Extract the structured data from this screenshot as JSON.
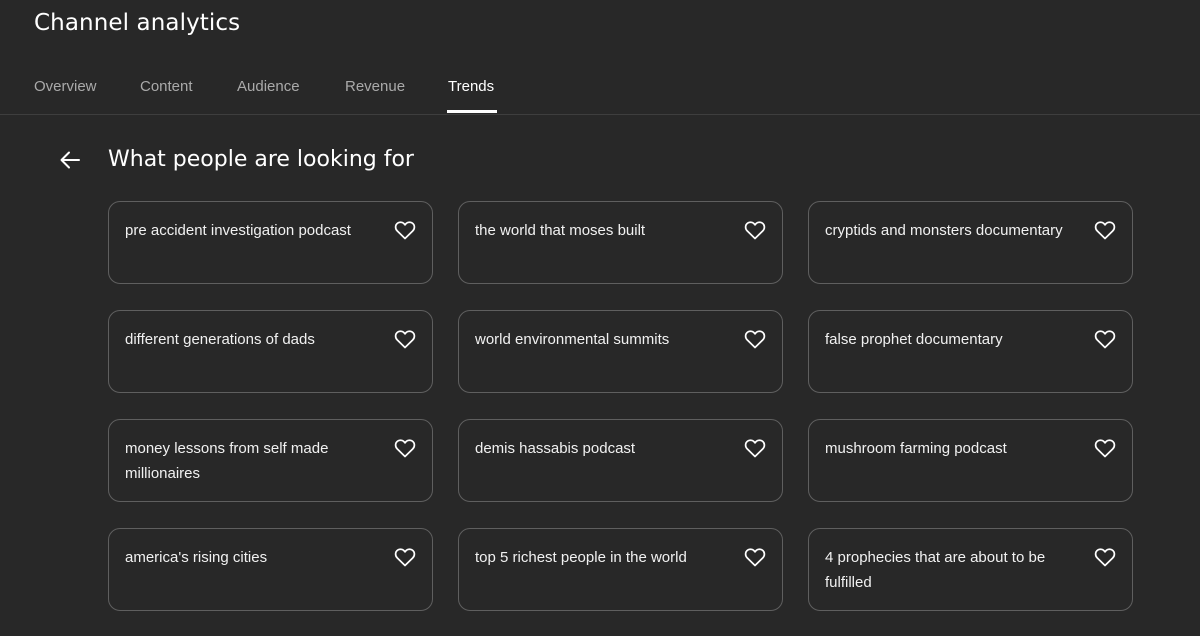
{
  "header": {
    "title": "Channel analytics"
  },
  "tabs": [
    {
      "label": "Overview",
      "active": false
    },
    {
      "label": "Content",
      "active": false
    },
    {
      "label": "Audience",
      "active": false
    },
    {
      "label": "Revenue",
      "active": false
    },
    {
      "label": "Trends",
      "active": true
    }
  ],
  "section": {
    "back_icon": "arrow-back-icon",
    "title": "What people are looking for"
  },
  "cards": [
    {
      "label": "pre accident investigation podcast",
      "icon": "heart-outline-icon"
    },
    {
      "label": "the world that moses built",
      "icon": "heart-outline-icon"
    },
    {
      "label": "cryptids and monsters documentary",
      "icon": "heart-outline-icon"
    },
    {
      "label": "different generations of dads",
      "icon": "heart-outline-icon"
    },
    {
      "label": "world environmental summits",
      "icon": "heart-outline-icon"
    },
    {
      "label": "false prophet documentary",
      "icon": "heart-outline-icon"
    },
    {
      "label": "money lessons from self made millionaires",
      "icon": "heart-outline-icon"
    },
    {
      "label": "demis hassabis podcast",
      "icon": "heart-outline-icon"
    },
    {
      "label": "mushroom farming podcast",
      "icon": "heart-outline-icon"
    },
    {
      "label": "america's rising cities",
      "icon": "heart-outline-icon"
    },
    {
      "label": "top 5 richest people in the world",
      "icon": "heart-outline-icon"
    },
    {
      "label": "4 prophecies that are about to be fulfilled",
      "icon": "heart-outline-icon"
    }
  ],
  "colors": {
    "background": "#282828",
    "card_border": "#5f5f5f",
    "tab_inactive": "#aaaaaa",
    "text": "#ffffff"
  }
}
